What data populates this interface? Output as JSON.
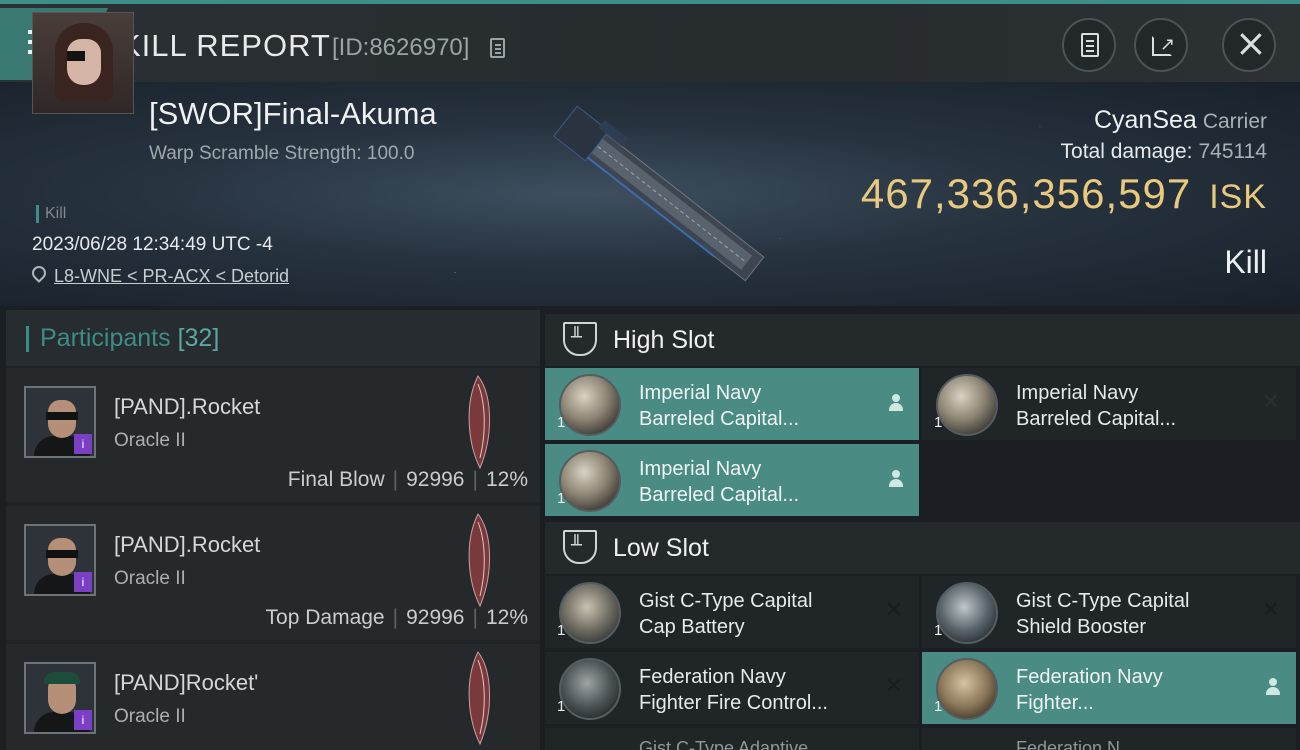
{
  "header": {
    "title": "KILL REPORT",
    "report_id": "[ID:8626970]"
  },
  "victim": {
    "name": "[SWOR]Final-Akuma",
    "warp_scramble": "Warp Scramble Strength: 100.0",
    "tag": "Kill",
    "datetime": "2023/06/28 12:34:49 UTC -4",
    "location": "L8-WNE < PR-ACX < Detorid",
    "corp": "CyanSea",
    "ship_class": "Carrier",
    "total_damage_label": "Total damage:",
    "total_damage": "745114",
    "isk_value": "467,336,356,597",
    "isk_unit": "ISK",
    "result": "Kill"
  },
  "participants": {
    "label": "Participants",
    "count": "[32]",
    "list": [
      {
        "name": "[PAND].Rocket",
        "ship": "Oracle II",
        "role": "Final Blow",
        "damage": "92996",
        "percent": "12%"
      },
      {
        "name": "[PAND].Rocket",
        "ship": "Oracle II",
        "role": "Top Damage",
        "damage": "92996",
        "percent": "12%"
      },
      {
        "name": "[PAND]Rocket'",
        "ship": "Oracle II"
      }
    ]
  },
  "fitting": {
    "high_label": "High Slot",
    "low_label": "Low Slot",
    "high": [
      {
        "name": "Imperial Navy\nBarreled Capital...",
        "qty": "1",
        "dropped": true
      },
      {
        "name": "Imperial Navy\nBarreled Capital...",
        "qty": "1",
        "dropped": false
      },
      {
        "name": "Imperial Navy\nBarreled Capital...",
        "qty": "1",
        "dropped": true
      }
    ],
    "low": [
      {
        "name": "Gist C-Type Capital\nCap Battery",
        "qty": "1",
        "dropped": false
      },
      {
        "name": "Gist C-Type Capital\nShield Booster",
        "qty": "1",
        "dropped": false
      },
      {
        "name": "Federation Navy\nFighter Fire Control...",
        "qty": "1",
        "dropped": false
      },
      {
        "name": "Federation Navy\nFighter...",
        "qty": "1",
        "dropped": true
      }
    ],
    "peek": [
      "Gist C-Type Adaptive",
      "Federation N"
    ]
  },
  "colors": {
    "accent": "#3c8f86",
    "isk": "#e8c97e",
    "dropped_bg": "#4a8c84",
    "badge": "#7b3fc4"
  }
}
